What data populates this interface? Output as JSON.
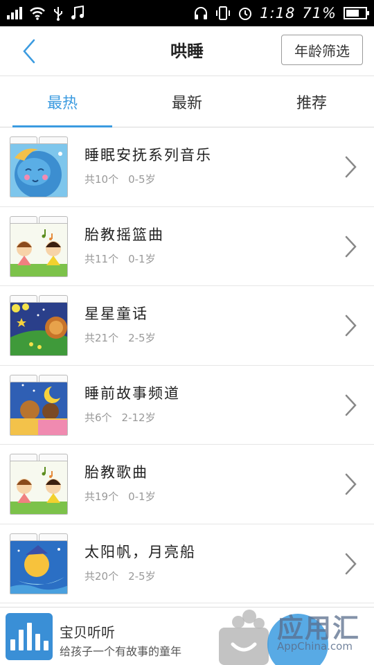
{
  "status_bar": {
    "time": "1:18",
    "battery": "71%"
  },
  "header": {
    "title": "哄睡",
    "filter_button": "年龄筛选"
  },
  "tabs": [
    {
      "label": "最热",
      "active": true
    },
    {
      "label": "最新",
      "active": false
    },
    {
      "label": "推荐",
      "active": false
    }
  ],
  "items": [
    {
      "title": "睡眠安抚系列音乐",
      "count": "共10个",
      "age": "0-5岁",
      "art": "moon-face"
    },
    {
      "title": "胎教摇篮曲",
      "count": "共11个",
      "age": "0-1岁",
      "art": "kids-singing"
    },
    {
      "title": "星星童话",
      "count": "共21个",
      "age": "2-5岁",
      "art": "night-lion"
    },
    {
      "title": "睡前故事频道",
      "count": "共6个",
      "age": "2-12岁",
      "art": "bears-in-bed"
    },
    {
      "title": "胎教歌曲",
      "count": "共19个",
      "age": "0-1岁",
      "art": "kids-singing"
    },
    {
      "title": "太阳帆，月亮船",
      "count": "共20个",
      "age": "2-5岁",
      "art": "moon-boat"
    }
  ],
  "banner": {
    "app_name": "宝贝听听",
    "app_desc": "给孩子一个有故事的童年"
  },
  "watermark": {
    "brand": "应用汇",
    "domain": "AppChina.com"
  },
  "colors": {
    "accent": "#3b9be0",
    "status_bar": "#000000",
    "banner_icon": "#3a8fd6"
  }
}
